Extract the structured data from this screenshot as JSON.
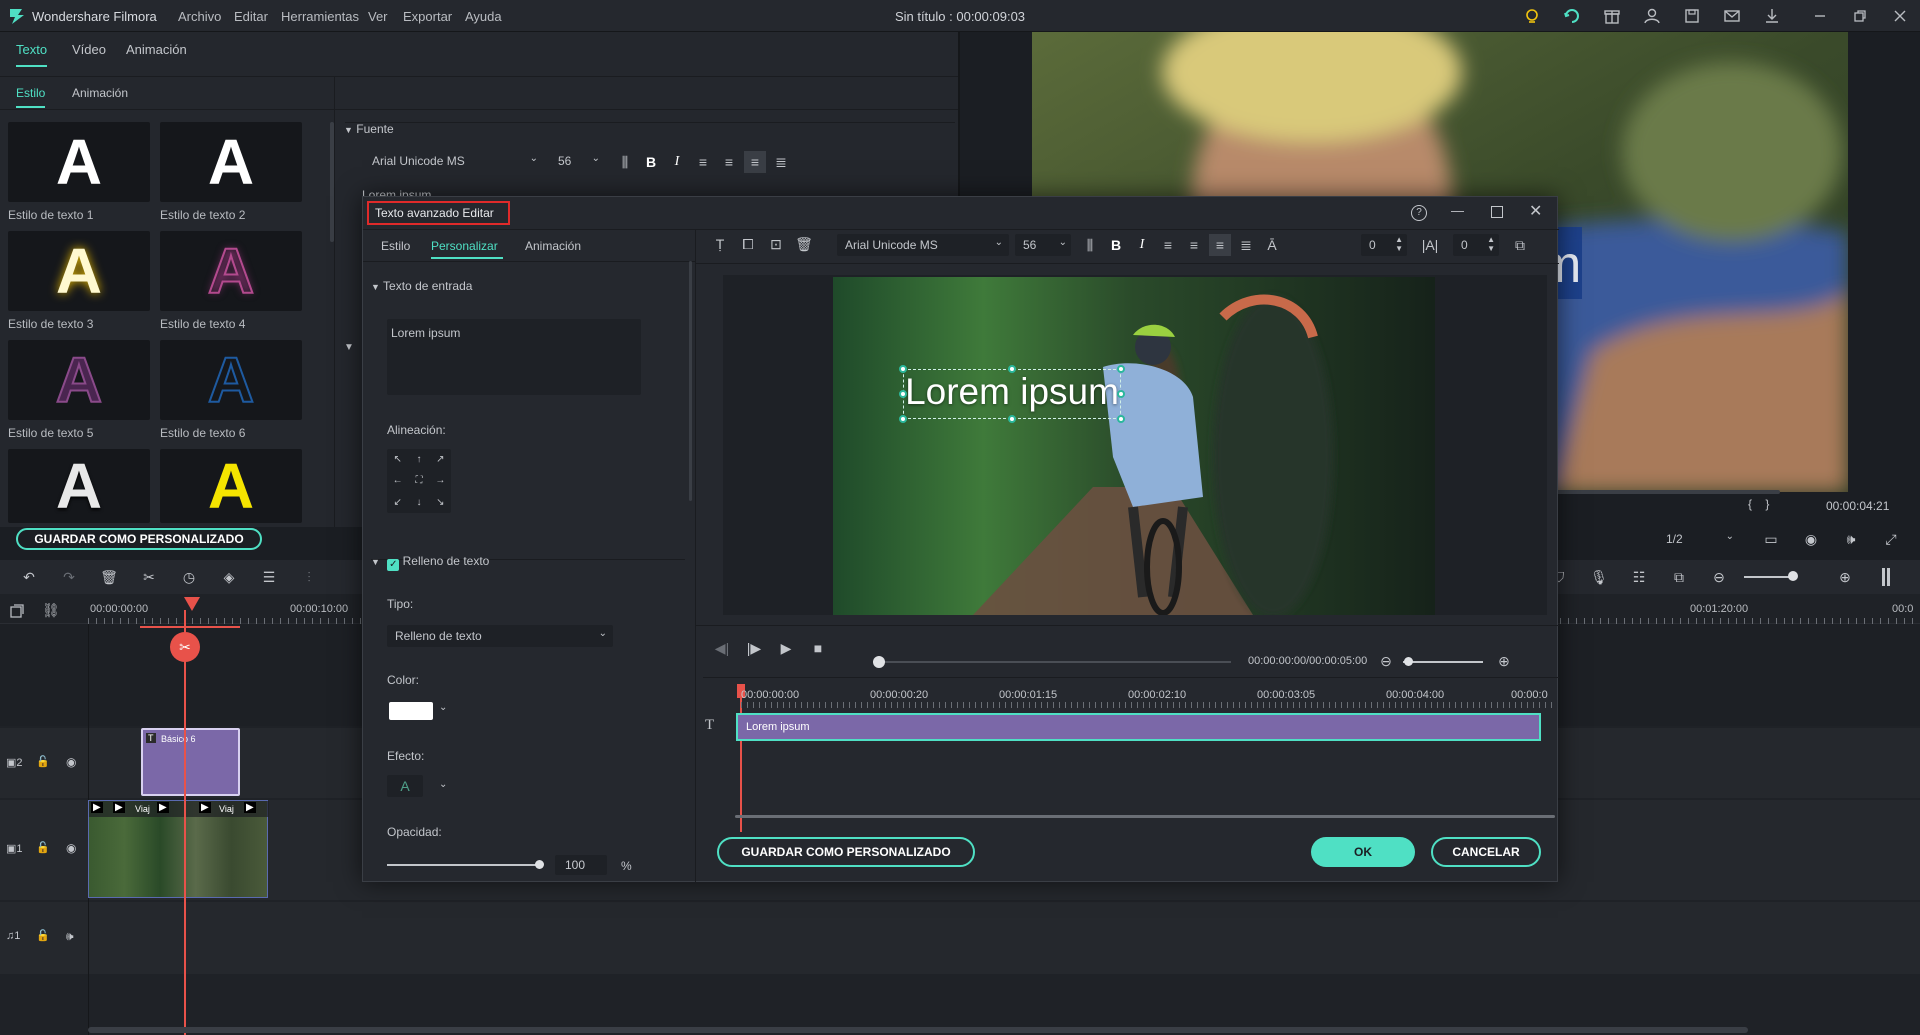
{
  "app": {
    "name": "Wondershare Filmora",
    "document_title": "Sin título : 00:00:09:03"
  },
  "menu": [
    "Archivo",
    "Editar",
    "Herramientas",
    "Ver",
    "Exportar",
    "Ayuda"
  ],
  "left_panel": {
    "top_tabs": [
      "Texto",
      "Vídeo",
      "Animación"
    ],
    "sub_tabs": [
      "Estilo",
      "Animación"
    ],
    "styles": [
      {
        "label": "Estilo de texto 1",
        "color": "#ffffff"
      },
      {
        "label": "Estilo de texto 2",
        "color": "#ffffff"
      },
      {
        "label": "Estilo de texto 3",
        "color": "#fff9d0"
      },
      {
        "label": "Estilo de texto 4",
        "color": "#b34a8e"
      },
      {
        "label": "Estilo de texto 5",
        "color": "#7a3b7a"
      },
      {
        "label": "Estilo de texto 6",
        "color": "#1e4e8c"
      },
      {
        "label": "",
        "color": "#ffffff"
      },
      {
        "label": "",
        "color": "#f5e400"
      }
    ],
    "save_custom": "GUARDAR COMO PERSONALIZADO",
    "font_section": "Fuente",
    "font_name": "Arial Unicode MS",
    "font_size": "56",
    "text_preview": "Lorem ipsum"
  },
  "preview": {
    "timecode": "00:00:04:21",
    "zoom": "1/2",
    "overlay_text_fragment": "m"
  },
  "timeline": {
    "ruler": [
      "00:00:00:00",
      "00:00:10:00",
      "00:01:20:00",
      "00:0"
    ],
    "clips": {
      "title_clip": "Básico 6",
      "video_clip": "Viaj"
    },
    "tracks": [
      "2",
      "1",
      "1"
    ]
  },
  "dialog": {
    "title": "Texto avanzado Editar",
    "tabs": [
      "Estilo",
      "Personalizar",
      "Animación"
    ],
    "active_tab": "Personalizar",
    "input_section": "Texto de entrada",
    "input_text": "Lorem ipsum",
    "alignment_label": "Alineación:",
    "fill_section": "Relleno de texto",
    "fill_checked": true,
    "type_label": "Tipo:",
    "type_value": "Relleno de texto",
    "color_label": "Color:",
    "fill_color": "#ffffff",
    "effect_label": "Efecto:",
    "opacity_label": "Opacidad:",
    "opacity_value": "100",
    "opacity_unit": "%",
    "opacity_level": 1.0,
    "font_name": "Arial Unicode MS",
    "font_size": "56",
    "char_spacing": "0",
    "line_spacing": "0",
    "canvas_text": "Lorem ipsum",
    "playback_time": "00:00:00:00/00:00:05:00",
    "ruler": [
      "00:00:00:00",
      "00:00:00:20",
      "00:00:01:15",
      "00:00:02:10",
      "00:00:03:05",
      "00:00:04:00",
      "00:00:0"
    ],
    "clip_label": "Lorem ipsum",
    "save_custom": "GUARDAR COMO PERSONALIZADO",
    "ok": "OK",
    "cancel": "CANCELAR"
  },
  "colors": {
    "accent": "#4fe0c4",
    "highlight_box": "#e02a2a",
    "text_clip": "#7b68a8",
    "playhead": "#e8524a"
  }
}
